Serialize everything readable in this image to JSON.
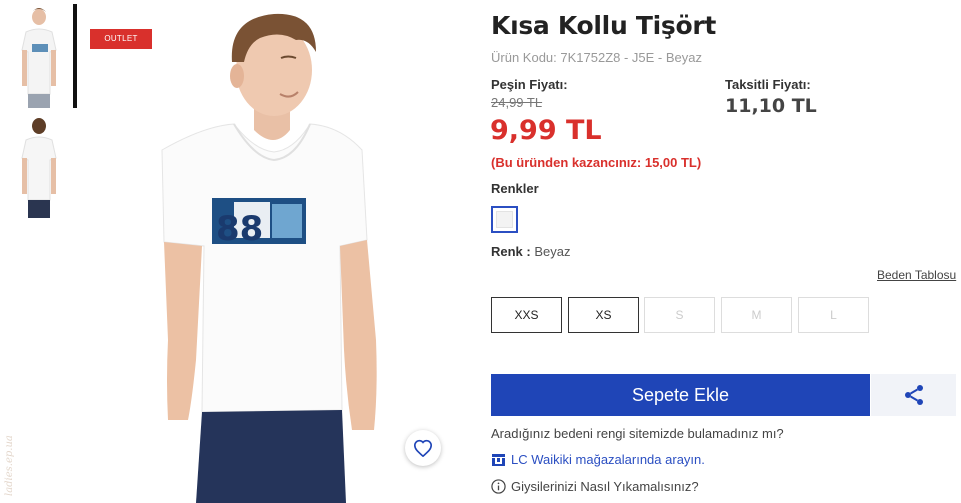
{
  "product": {
    "title": "Kısa Kollu Tişört",
    "code": "Ürün Kodu: 7K1752Z8 - J5E - Beyaz",
    "badge": "OUTLET",
    "tshirt_print": "88"
  },
  "price": {
    "cash_label": "Peşin Fiyatı:",
    "old": "24,99 TL",
    "new": "9,99 TL",
    "savings": "(Bu üründen kazancınız: 15,00 TL)",
    "installment_label": "Taksitli Fiyatı:",
    "installment": "11,10 TL"
  },
  "colors": {
    "label": "Renkler",
    "selected_label": "Renk :",
    "selected_value": "Beyaz",
    "swatch_color": "#f3f3f3"
  },
  "sizes": {
    "chart_link": "Beden Tablosu",
    "items": [
      {
        "label": "XXS",
        "available": true
      },
      {
        "label": "XS",
        "available": true
      },
      {
        "label": "S",
        "available": false
      },
      {
        "label": "M",
        "available": false
      },
      {
        "label": "L",
        "available": false
      }
    ]
  },
  "actions": {
    "add_to_cart": "Sepete Ekle",
    "not_found": "Aradığınız bedeni rengi sitemizde bulamadınız mı?",
    "store_search": "LC Waikiki mağazalarında arayın.",
    "washing": "Giysilerinizi Nasıl Yıkamalısınız?"
  },
  "icons": {
    "favorite": "heart-icon",
    "share": "share-icon",
    "store": "store-icon",
    "info": "info-icon"
  },
  "watermark": "ladies.ep.ua",
  "theme": {
    "accent": "#1f45b7",
    "price_red": "#d9302c"
  }
}
